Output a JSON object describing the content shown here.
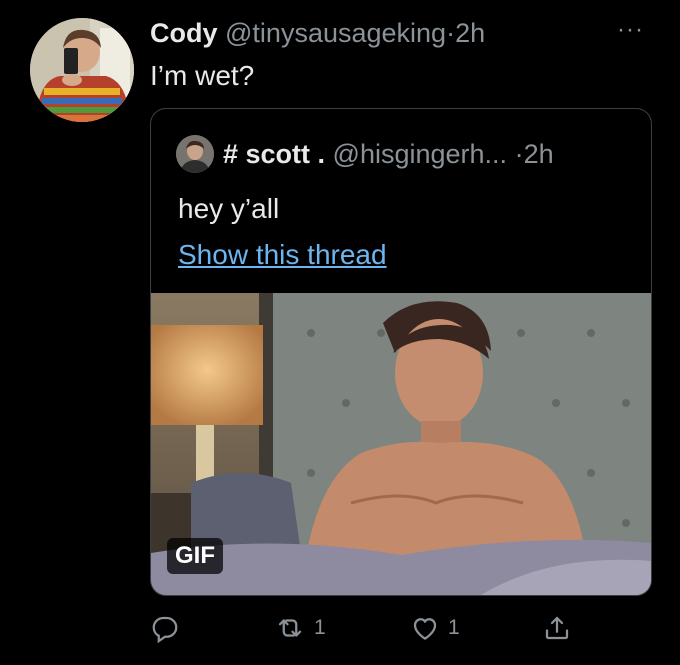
{
  "tweet": {
    "display_name": "Cody",
    "handle": "@tinysausageking",
    "separator": "·",
    "time": "2h",
    "text": "I’m wet?",
    "more_label": "···"
  },
  "quoted_tweet": {
    "display_name": "# scott .",
    "handle": "@hisgingerh...",
    "separator": "·",
    "time": "2h",
    "text": "hey y’all",
    "thread_link": "Show this thread",
    "media_badge": "GIF"
  },
  "actions": {
    "reply_icon": "reply-icon",
    "retweet_icon": "retweet-icon",
    "retweet_count": "1",
    "like_icon": "heart-icon",
    "like_count": "1",
    "share_icon": "share-icon"
  },
  "colors": {
    "background": "#000000",
    "text": "#e7e9ea",
    "secondary": "#8b9298",
    "link": "#6cb5f0",
    "border": "#3a3f44"
  }
}
